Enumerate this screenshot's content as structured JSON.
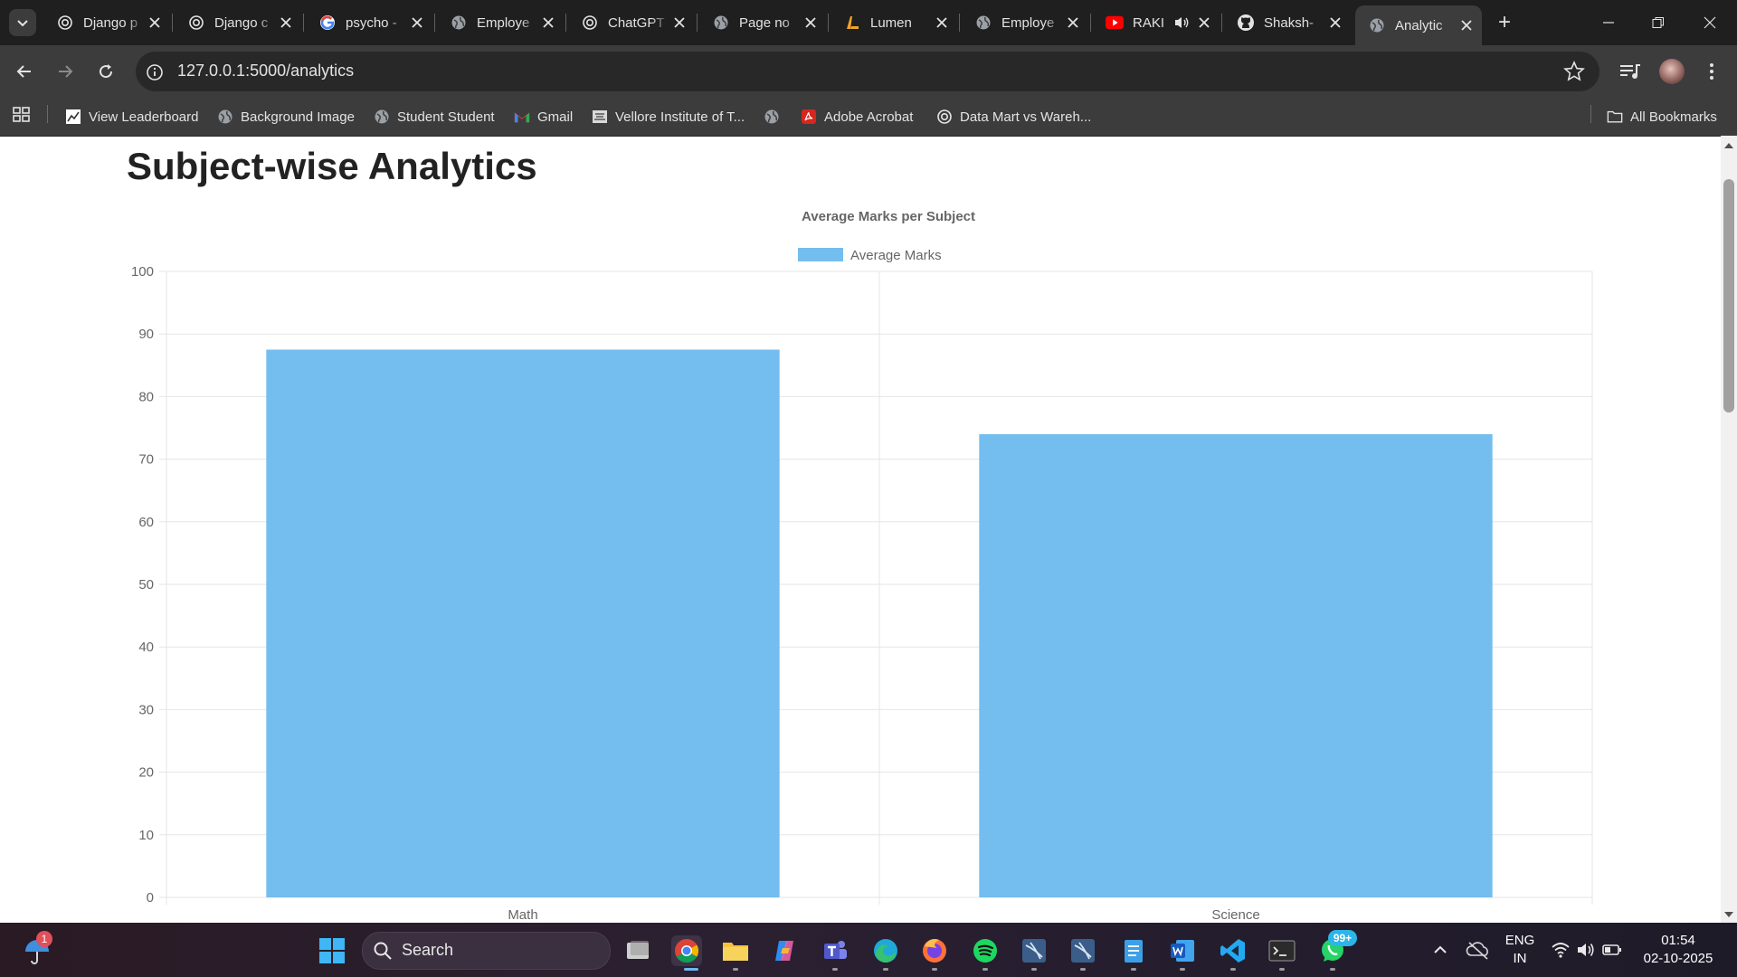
{
  "browser": {
    "tabs": [
      {
        "label": "Django p",
        "icon": "chatgpt-icon"
      },
      {
        "label": "Django c",
        "icon": "chatgpt-icon"
      },
      {
        "label": "psycho -",
        "icon": "google-icon"
      },
      {
        "label": "Employe",
        "icon": "globe-icon"
      },
      {
        "label": "ChatGPT",
        "icon": "chatgpt-icon"
      },
      {
        "label": "Page no",
        "icon": "globe-icon"
      },
      {
        "label": "Lumen",
        "icon": "lumen-icon"
      },
      {
        "label": "Employe",
        "icon": "globe-icon"
      },
      {
        "label": "RAKI",
        "icon": "youtube-icon"
      },
      {
        "label": "Shaksh-",
        "icon": "github-icon"
      },
      {
        "label": "Analytic",
        "icon": "globe-icon",
        "active": true
      }
    ],
    "url": "127.0.0.1:5000/analytics",
    "bookmarks": [
      {
        "label": "View Leaderboard",
        "icon": "chart-line-icon"
      },
      {
        "label": "Background Image",
        "icon": "globe-icon"
      },
      {
        "label": "Student Student",
        "icon": "globe-icon"
      },
      {
        "label": "Gmail",
        "icon": "gmail-icon"
      },
      {
        "label": "Vellore Institute of T...",
        "icon": "vit-icon"
      },
      {
        "label": "",
        "icon": "globe-icon"
      },
      {
        "label": "Adobe Acrobat",
        "icon": "acrobat-icon"
      },
      {
        "label": "Data Mart vs Wareh...",
        "icon": "chatgpt-icon"
      }
    ],
    "all_bookmarks": "All Bookmarks"
  },
  "page": {
    "title": "Subject-wise Analytics"
  },
  "chart_data": {
    "type": "bar",
    "title": "Average Marks per Subject",
    "categories": [
      "Math",
      "Science"
    ],
    "series": [
      {
        "name": "Average Marks",
        "values": [
          87.5,
          74
        ]
      }
    ],
    "ylim": [
      0,
      100
    ],
    "yticks": [
      0,
      10,
      20,
      30,
      40,
      50,
      60,
      70,
      80,
      90,
      100
    ],
    "grid": true,
    "legend": "top",
    "bar_color": "#73bdef"
  },
  "taskbar": {
    "search_placeholder": "Search",
    "notification_badge": "1",
    "whatsapp_badge": "99+",
    "lang_line1": "ENG",
    "lang_line2": "IN",
    "time": "01:54",
    "date": "02-10-2025"
  }
}
